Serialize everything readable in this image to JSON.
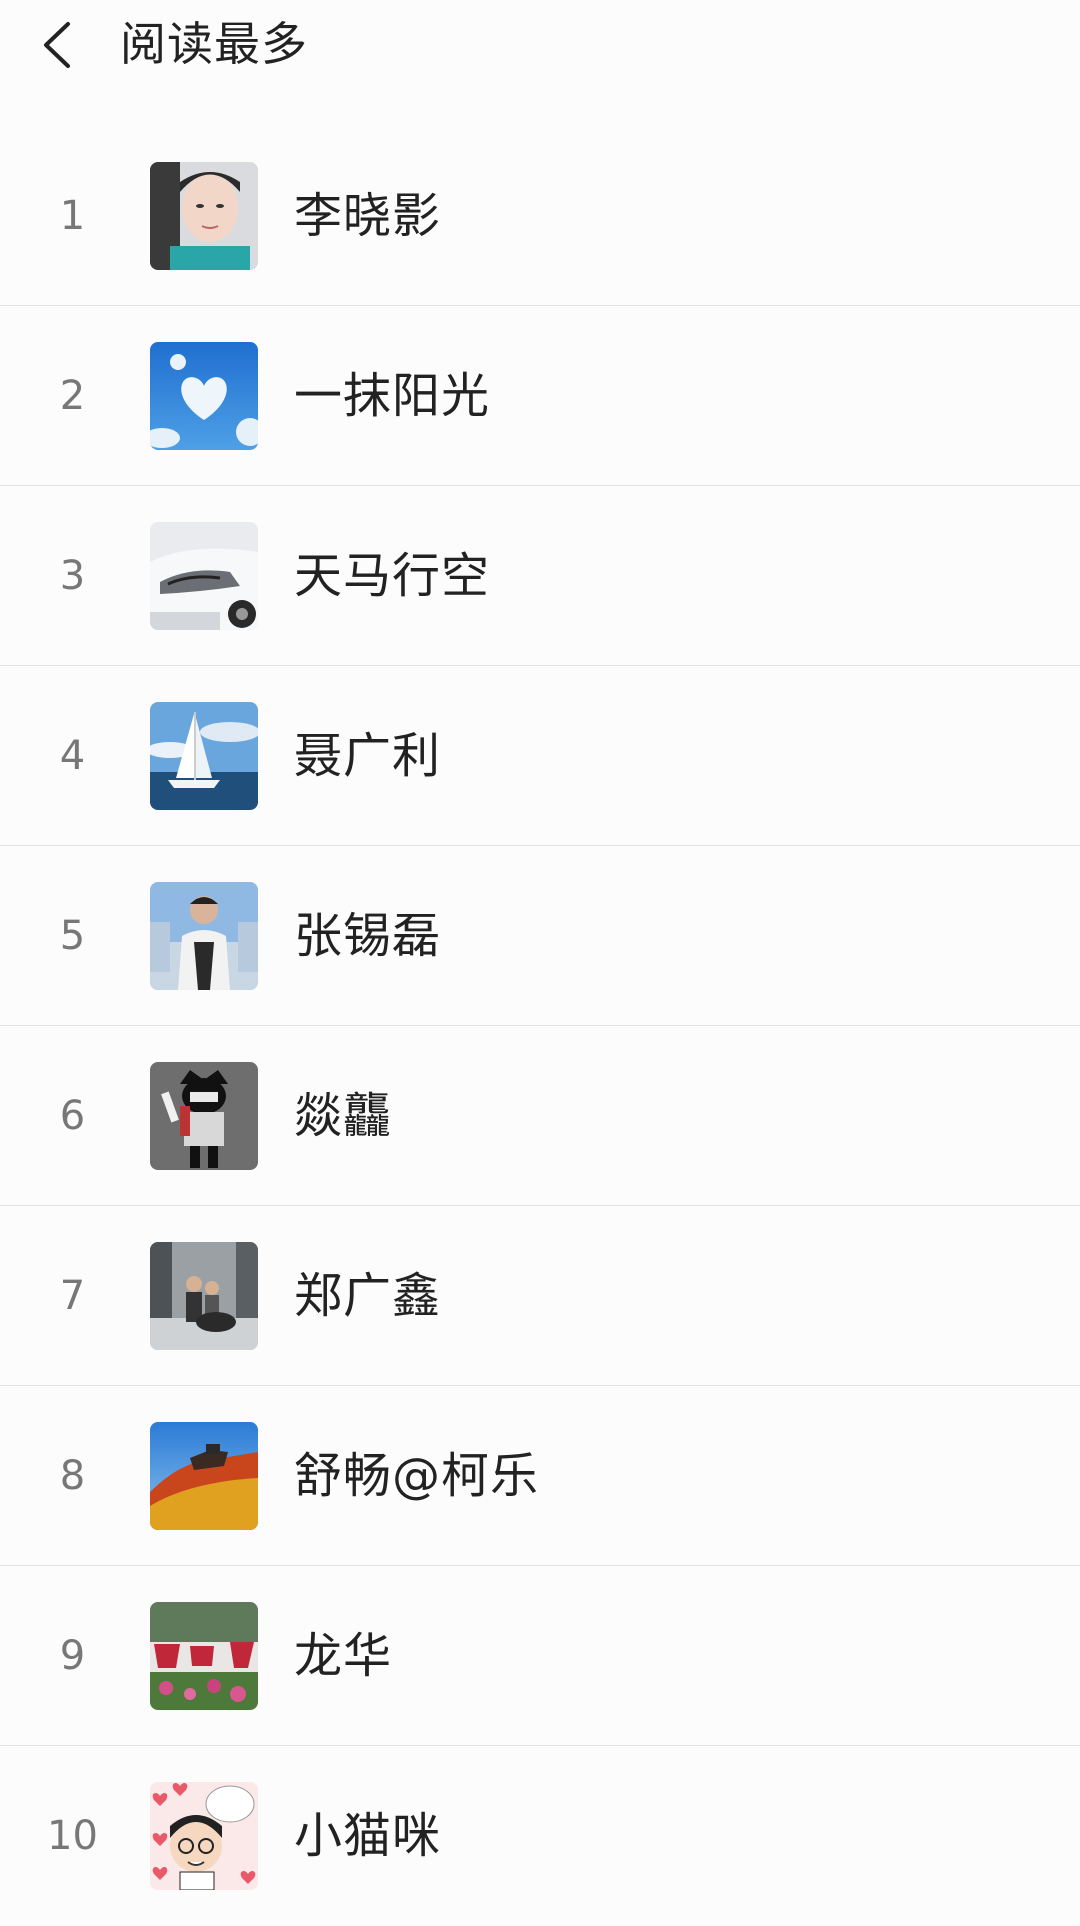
{
  "header": {
    "title": "阅读最多",
    "back_icon": "chevron-left-icon"
  },
  "list": {
    "items": [
      {
        "rank": "1",
        "name": "李晓影",
        "avatar": "woman-portrait-avatar"
      },
      {
        "rank": "2",
        "name": "一抹阳光",
        "avatar": "heart-cloud-sky-avatar"
      },
      {
        "rank": "3",
        "name": "天马行空",
        "avatar": "white-car-avatar"
      },
      {
        "rank": "4",
        "name": "聂广利",
        "avatar": "sailboat-avatar"
      },
      {
        "rank": "5",
        "name": "张锡磊",
        "avatar": "man-portrait-avatar"
      },
      {
        "rank": "6",
        "name": "燚龘",
        "avatar": "cartoon-character-avatar"
      },
      {
        "rank": "7",
        "name": "郑广鑫",
        "avatar": "people-outdoor-avatar"
      },
      {
        "rank": "8",
        "name": "舒畅@柯乐",
        "avatar": "great-wall-avatar"
      },
      {
        "rank": "9",
        "name": "龙华",
        "avatar": "flower-garden-avatar"
      },
      {
        "rank": "10",
        "name": "小猫咪",
        "avatar": "cartoon-face-hearts-avatar"
      }
    ]
  },
  "colors": {
    "background": "#fdfcfd",
    "divider": "#e4e2e4",
    "rank_text": "#777777",
    "name_text": "#222222"
  }
}
